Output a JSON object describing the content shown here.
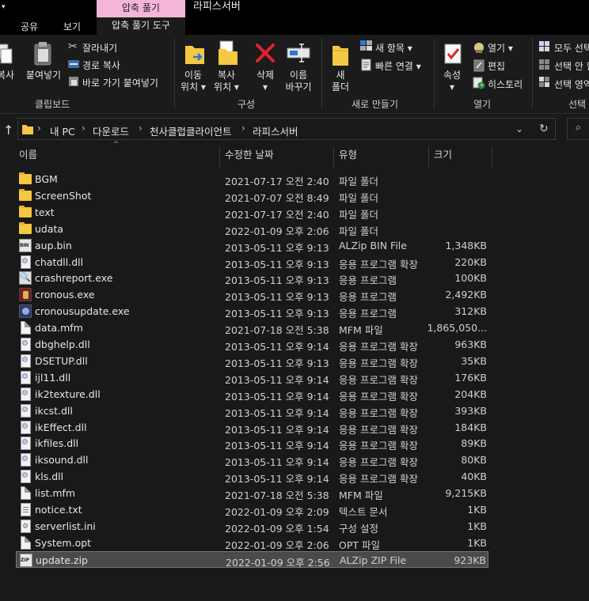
{
  "window": {
    "title": "라피스서버",
    "context_header": "압축 풀기",
    "title_caret": "▾"
  },
  "tabs": [
    {
      "label": "공유"
    },
    {
      "label": "보기"
    },
    {
      "label": "압축 풀기 도구"
    }
  ],
  "ribbon": {
    "clipboard": {
      "label": "클립보드",
      "copy": "복사",
      "paste": "붙여넣기",
      "cut": "잘라내기",
      "copy_path": "경로 복사",
      "paste_shortcut": "바로 가기 붙여넣기"
    },
    "organize": {
      "label": "구성",
      "move_to_1": "이동",
      "move_to_2": "위치 ▾",
      "copy_to_1": "복사",
      "copy_to_2": "위치 ▾",
      "delete_1": "삭제",
      "delete_2": "▾",
      "rename_1": "이름",
      "rename_2": "바꾸기"
    },
    "new": {
      "label": "새로 만들기",
      "new_folder_1": "새",
      "new_folder_2": "폴더",
      "new_item": "새 항목 ▾",
      "easy_access": "빠른 연결 ▾"
    },
    "open": {
      "label": "열기",
      "properties": "속성",
      "properties_caret": "▾",
      "open": "열기 ▾",
      "edit": "편집",
      "history": "히스토리"
    },
    "select": {
      "label": "선택",
      "select_all": "모두 선택",
      "select_none": "선택 안 함",
      "invert": "선택 영역 반전"
    }
  },
  "address": {
    "back": "↑",
    "crumbs": [
      "내 PC",
      "다운로드",
      "천사클럽클라이언트",
      "라피스서버"
    ],
    "separator": "›",
    "dropdown": "⌄",
    "refresh": "↻",
    "search_glyph": "⌕"
  },
  "columns": {
    "name": "이름",
    "date": "수정한 날짜",
    "type": "유형",
    "size": "크기",
    "sort": "^"
  },
  "files": [
    {
      "name": "BGM",
      "date": "2021-07-17 오전 2:40",
      "type": "파일 폴더",
      "size": "",
      "icon": "folder-icon"
    },
    {
      "name": "ScreenShot",
      "date": "2021-07-07 오전 8:49",
      "type": "파일 폴더",
      "size": "",
      "icon": "folder-icon"
    },
    {
      "name": "text",
      "date": "2021-07-17 오전 2:40",
      "type": "파일 폴더",
      "size": "",
      "icon": "folder-icon"
    },
    {
      "name": "udata",
      "date": "2022-01-09 오후 2:06",
      "type": "파일 폴더",
      "size": "",
      "icon": "folder-icon"
    },
    {
      "name": "aup.bin",
      "date": "2013-05-11 오후 9:13",
      "type": "ALZip BIN File",
      "size": "1,348KB",
      "icon": "bin-file-icon"
    },
    {
      "name": "chatdll.dll",
      "date": "2013-05-11 오후 9:13",
      "type": "응용 프로그램 확장",
      "size": "220KB",
      "icon": "dll-file-icon"
    },
    {
      "name": "crashreport.exe",
      "date": "2013-05-11 오후 9:13",
      "type": "응용 프로그램",
      "size": "100KB",
      "icon": "exe-crashreport-icon"
    },
    {
      "name": "cronous.exe",
      "date": "2013-05-11 오후 9:13",
      "type": "응용 프로그램",
      "size": "2,492KB",
      "icon": "exe-cronous-icon"
    },
    {
      "name": "cronousupdate.exe",
      "date": "2013-05-11 오후 9:13",
      "type": "응용 프로그램",
      "size": "312KB",
      "icon": "exe-update-icon"
    },
    {
      "name": "data.mfm",
      "date": "2021-07-18 오전 5:38",
      "type": "MFM 파일",
      "size": "1,865,050...",
      "icon": "file-icon"
    },
    {
      "name": "dbghelp.dll",
      "date": "2013-05-11 오후 9:14",
      "type": "응용 프로그램 확장",
      "size": "963KB",
      "icon": "dll-file-icon"
    },
    {
      "name": "DSETUP.dll",
      "date": "2013-05-11 오후 9:13",
      "type": "응용 프로그램 확장",
      "size": "35KB",
      "icon": "dll-file-icon"
    },
    {
      "name": "ijl11.dll",
      "date": "2013-05-11 오후 9:14",
      "type": "응용 프로그램 확장",
      "size": "176KB",
      "icon": "dll-file-icon"
    },
    {
      "name": "ik2texture.dll",
      "date": "2013-05-11 오후 9:14",
      "type": "응용 프로그램 확장",
      "size": "204KB",
      "icon": "dll-file-icon"
    },
    {
      "name": "ikcst.dll",
      "date": "2013-05-11 오후 9:14",
      "type": "응용 프로그램 확장",
      "size": "393KB",
      "icon": "dll-file-icon"
    },
    {
      "name": "ikEffect.dll",
      "date": "2013-05-11 오후 9:14",
      "type": "응용 프로그램 확장",
      "size": "184KB",
      "icon": "dll-file-icon"
    },
    {
      "name": "ikfiles.dll",
      "date": "2013-05-11 오후 9:14",
      "type": "응용 프로그램 확장",
      "size": "89KB",
      "icon": "dll-file-icon"
    },
    {
      "name": "iksound.dll",
      "date": "2013-05-11 오후 9:14",
      "type": "응용 프로그램 확장",
      "size": "80KB",
      "icon": "dll-file-icon"
    },
    {
      "name": "kls.dll",
      "date": "2013-05-11 오후 9:14",
      "type": "응용 프로그램 확장",
      "size": "40KB",
      "icon": "dll-file-icon"
    },
    {
      "name": "list.mfm",
      "date": "2021-07-18 오전 5:38",
      "type": "MFM 파일",
      "size": "9,215KB",
      "icon": "file-icon"
    },
    {
      "name": "notice.txt",
      "date": "2022-01-09 오후 2:09",
      "type": "텍스트 문서",
      "size": "1KB",
      "icon": "text-file-icon"
    },
    {
      "name": "serverlist.ini",
      "date": "2022-01-09 오후 1:54",
      "type": "구성 설정",
      "size": "1KB",
      "icon": "ini-file-icon"
    },
    {
      "name": "System.opt",
      "date": "2022-01-09 오후 2:06",
      "type": "OPT 파일",
      "size": "1KB",
      "icon": "file-icon"
    },
    {
      "name": "update.zip",
      "date": "2022-01-09 오후 2:56",
      "type": "ALZip ZIP File",
      "size": "923KB",
      "icon": "zip-file-icon",
      "selected": true
    }
  ],
  "colors": {
    "background": "#191919",
    "ribbon": "#1b1b1b",
    "context_tab": "#f4b5d9",
    "selection": "#4a4a4a",
    "folder": "#f5c842",
    "delete_red": "#e5212d"
  }
}
